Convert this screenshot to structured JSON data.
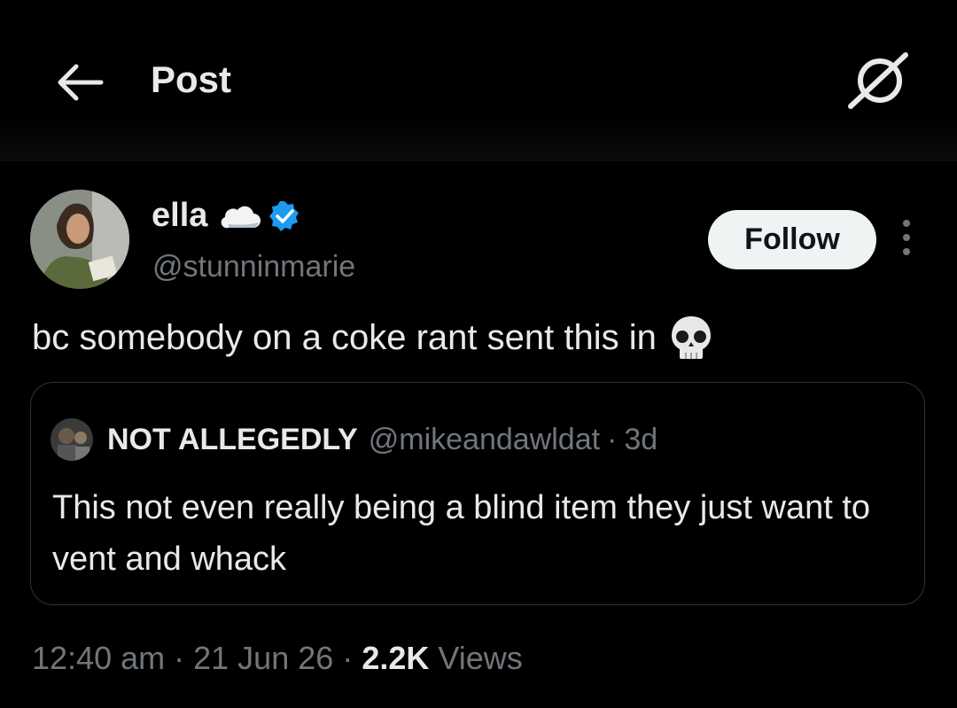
{
  "header": {
    "title": "Post",
    "back_icon": "arrow-left-icon",
    "grok_icon": "grok-icon"
  },
  "author": {
    "display_name": "ella",
    "handle": "@stunninmarie",
    "name_emoji": "cloud-icon",
    "verified": true,
    "verified_color": "#1d9bf0"
  },
  "actions": {
    "follow_label": "Follow",
    "more_icon": "more-vertical-icon"
  },
  "post": {
    "text": "bc somebody on a coke rant sent this in",
    "emoji": "skull-icon"
  },
  "quote": {
    "display_name": "NOT ALLEGEDLY",
    "handle": "@mikeandawldat",
    "separator": "·",
    "time": "3d",
    "text": "This not even really being a blind item they just want to vent and whack"
  },
  "meta": {
    "time": "12:40 am",
    "sep1": "·",
    "date": "21 Jun 26",
    "sep2": "·",
    "views_count": "2.2K",
    "views_label": "Views"
  },
  "colors": {
    "background": "#000000",
    "text_primary": "#e7e9ea",
    "text_secondary": "#71767b",
    "border": "#2f3336",
    "follow_bg": "#eff3f4"
  }
}
